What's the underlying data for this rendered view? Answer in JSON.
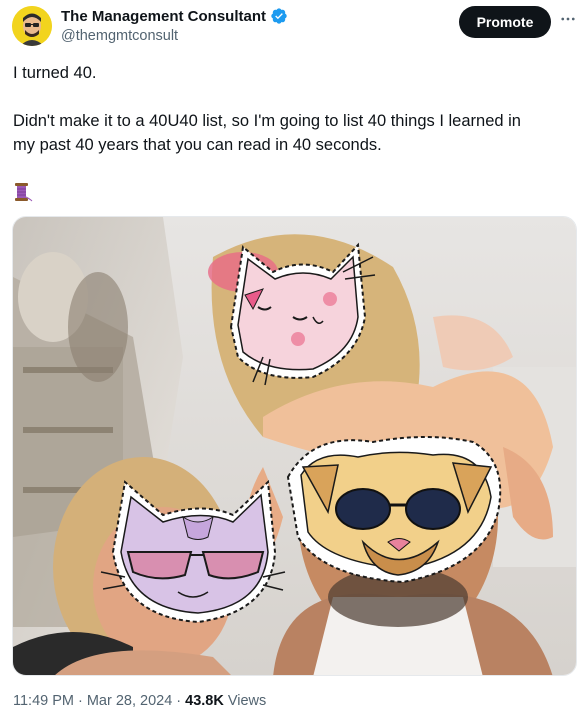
{
  "author": {
    "display_name": "The Management Consultant",
    "handle": "@themgmtconsult",
    "verified_icon": "verified-badge-icon",
    "avatar_icon": "avatar-illustration"
  },
  "actions": {
    "promote_label": "Promote",
    "more_icon": "more-horizontal-icon"
  },
  "tweet": {
    "line1": "I turned 40.",
    "line2": "Didn't make it to a 40U40 list, so I'm going to list 40 things I learned in",
    "line3": "my past 40 years that you can read in 40 seconds.",
    "emoji_icon": "thread-spool-emoji"
  },
  "media": {
    "photo": "family-selfie-photo",
    "stickers": [
      "cat-sticker-pink",
      "pug-sticker-sunglasses",
      "cat-sticker-purple-sunglasses"
    ]
  },
  "meta": {
    "time": "11:49 PM",
    "separator1": "·",
    "date": "Mar 28, 2024",
    "separator2": "·",
    "views_count": "43.8K",
    "views_label": "Views"
  },
  "colors": {
    "text": "#0f1419",
    "secondary": "#536471",
    "verified": "#1d9bf0",
    "promote_bg": "#0f1419"
  }
}
